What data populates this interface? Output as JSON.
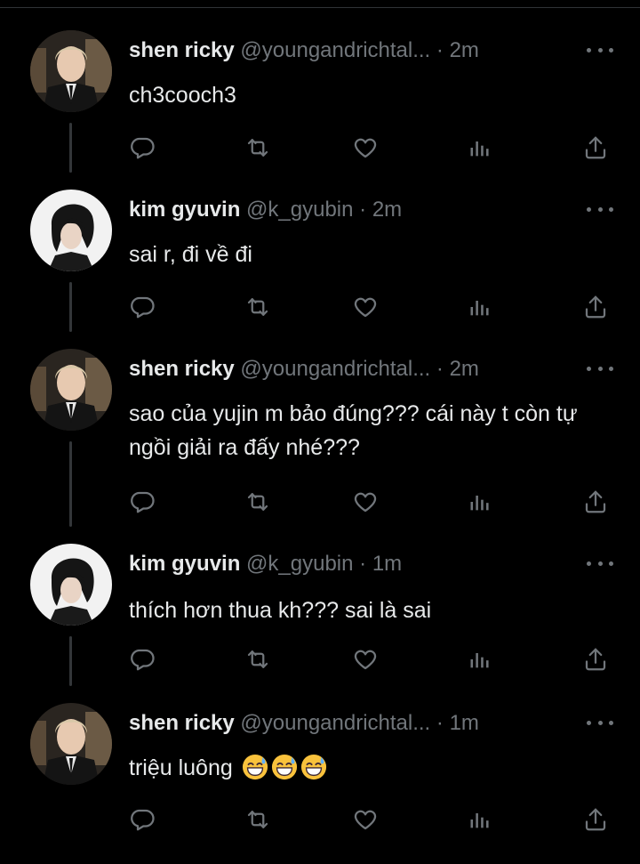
{
  "thread": [
    {
      "avatar": "ricky",
      "name": "shen ricky",
      "handle": "@youngandrichtal...",
      "separator": "·",
      "time": "2m",
      "text": "ch3cooch3"
    },
    {
      "avatar": "gyuvin",
      "name": "kim gyuvin",
      "handle": "@k_gyubin",
      "separator": "·",
      "time": "2m",
      "text": "sai r, đi về đi"
    },
    {
      "avatar": "ricky",
      "name": "shen ricky",
      "handle": "@youngandrichtal...",
      "separator": "·",
      "time": "2m",
      "text": "sao của yujin m bảo đúng??? cái này t còn tự ngồi giải ra đấy nhé???"
    },
    {
      "avatar": "gyuvin",
      "name": "kim gyuvin",
      "handle": "@k_gyubin",
      "separator": "·",
      "time": "1m",
      "text": "thích hơn thua kh??? sai là sai"
    },
    {
      "avatar": "ricky",
      "name": "shen ricky",
      "handle": "@youngandrichtal...",
      "separator": "·",
      "time": "1m",
      "text": "triệu luông"
    }
  ],
  "last_tweet_emojis": [
    "grinning-sweat-emoji",
    "grinning-sweat-emoji",
    "grinning-sweat-emoji"
  ],
  "action_icons": [
    "reply-icon",
    "retweet-icon",
    "like-icon",
    "views-icon",
    "share-icon"
  ],
  "more_icon": "more-horizontal-icon",
  "colors": {
    "background": "#000000",
    "text": "#e7e9ea",
    "secondary": "#71767b",
    "thread_line": "#333639"
  }
}
